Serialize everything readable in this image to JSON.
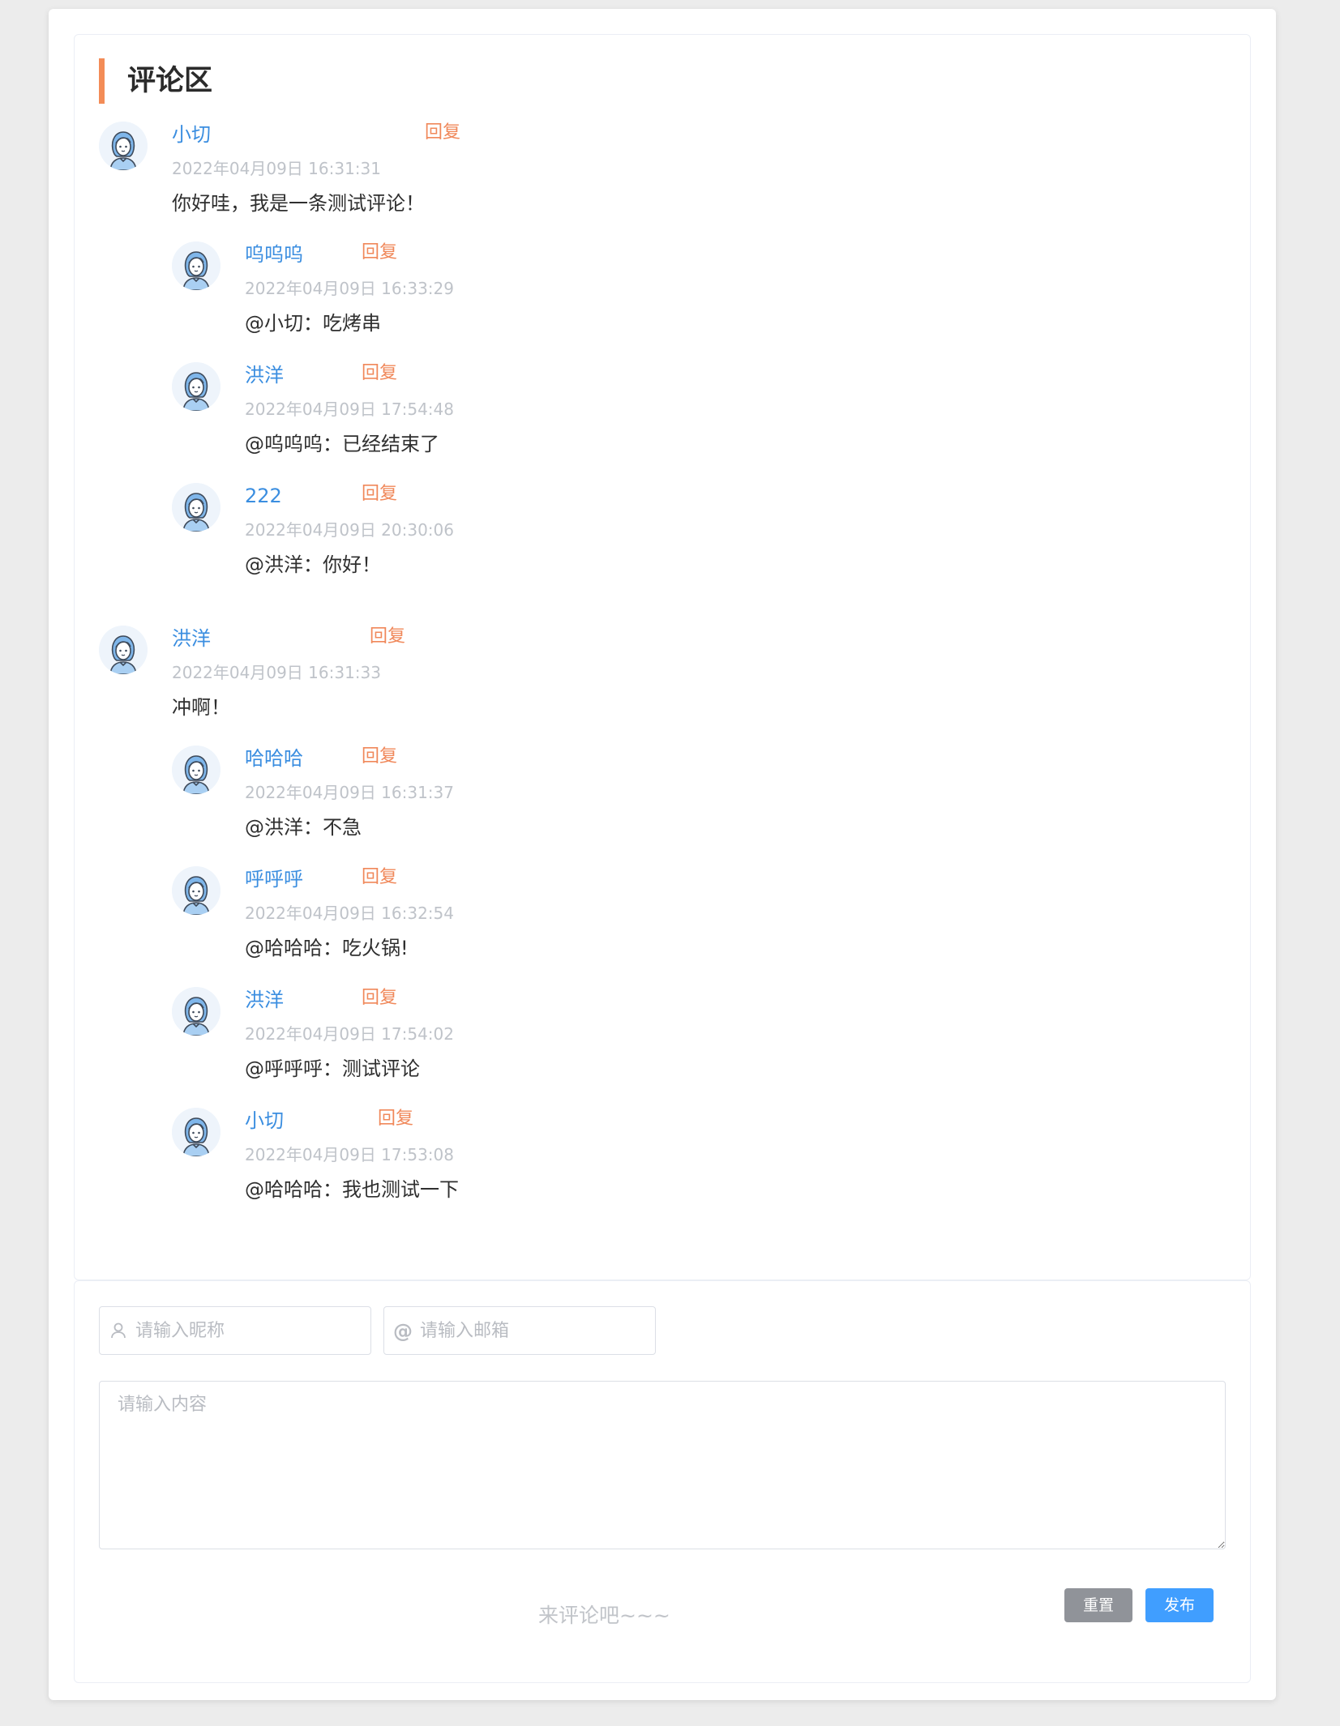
{
  "section_title": "评论区",
  "reply_label": "回复",
  "comments": [
    {
      "username": "小切",
      "time": "2022年04月09日 16:31:31",
      "content": "你好哇，我是一条测试评论！",
      "replies": [
        {
          "username": "呜呜呜",
          "time": "2022年04月09日 16:33:29",
          "content": "@小切：吃烤串"
        },
        {
          "username": "洪洋",
          "time": "2022年04月09日 17:54:48",
          "content": "@呜呜呜：已经结束了"
        },
        {
          "username": "222",
          "time": "2022年04月09日 20:30:06",
          "content": "@洪洋：你好！"
        }
      ]
    },
    {
      "username": "洪洋",
      "time": "2022年04月09日 16:31:33",
      "content": "冲啊！",
      "replies": [
        {
          "username": "哈哈哈",
          "time": "2022年04月09日 16:31:37",
          "content": "@洪洋：不急"
        },
        {
          "username": "呼呼呼",
          "time": "2022年04月09日 16:32:54",
          "content": "@哈哈哈：吃火锅!"
        },
        {
          "username": "洪洋",
          "time": "2022年04月09日 17:54:02",
          "content": "@呼呼呼：测试评论"
        },
        {
          "username": "小切",
          "time": "2022年04月09日 17:53:08",
          "content": "@哈哈哈：我也测试一下"
        }
      ]
    }
  ],
  "form": {
    "nickname_placeholder": "请输入昵称",
    "email_placeholder": "请输入邮箱",
    "content_placeholder": "请输入内容",
    "hint": "来评论吧~~~",
    "reset_label": "重置",
    "publish_label": "发布"
  },
  "icons": {
    "avatar": "avatar-icon",
    "nickname": "user-icon",
    "email": "at-icon"
  },
  "colors": {
    "username": "#3b8ee0",
    "reply": "#f0885a",
    "title_accent": "#f38c57",
    "publish": "#409eff",
    "reset": "#909399"
  }
}
